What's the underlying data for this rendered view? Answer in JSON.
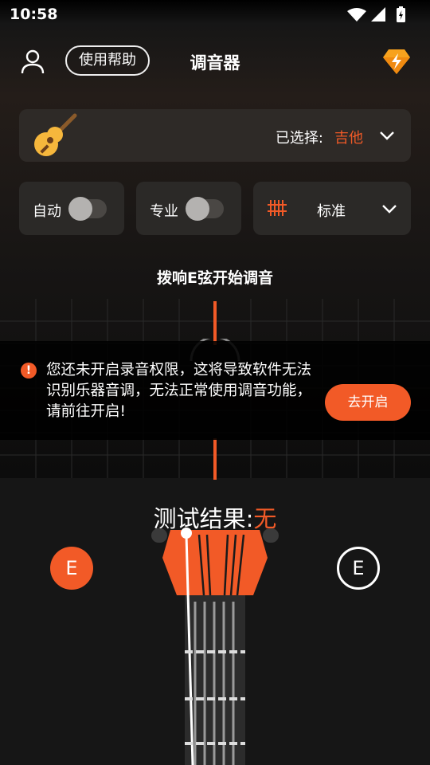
{
  "status_bar": {
    "time": "10:58"
  },
  "header": {
    "help_label": "使用帮助",
    "title": "调音器"
  },
  "instrument": {
    "selected_label": "已选择:",
    "selected_value": "吉他"
  },
  "options": {
    "auto_label": "自动",
    "pro_label": "专业",
    "tuning_label": "标准",
    "auto_enabled": false,
    "pro_enabled": false
  },
  "prompt": "拨响E弦开始调音",
  "permission": {
    "message": "您还未开启录音权限，这将导致软件无法识别乐器音调，无法正常使用调音功能，请前往开启!",
    "button_label": "去开启"
  },
  "result": {
    "label": "测试结果:",
    "value": "无"
  },
  "strings": {
    "left_note": "E",
    "right_note": "E"
  },
  "colors": {
    "accent": "#f25a27",
    "background": "#0b0b0b",
    "card": "#2e2a27"
  }
}
